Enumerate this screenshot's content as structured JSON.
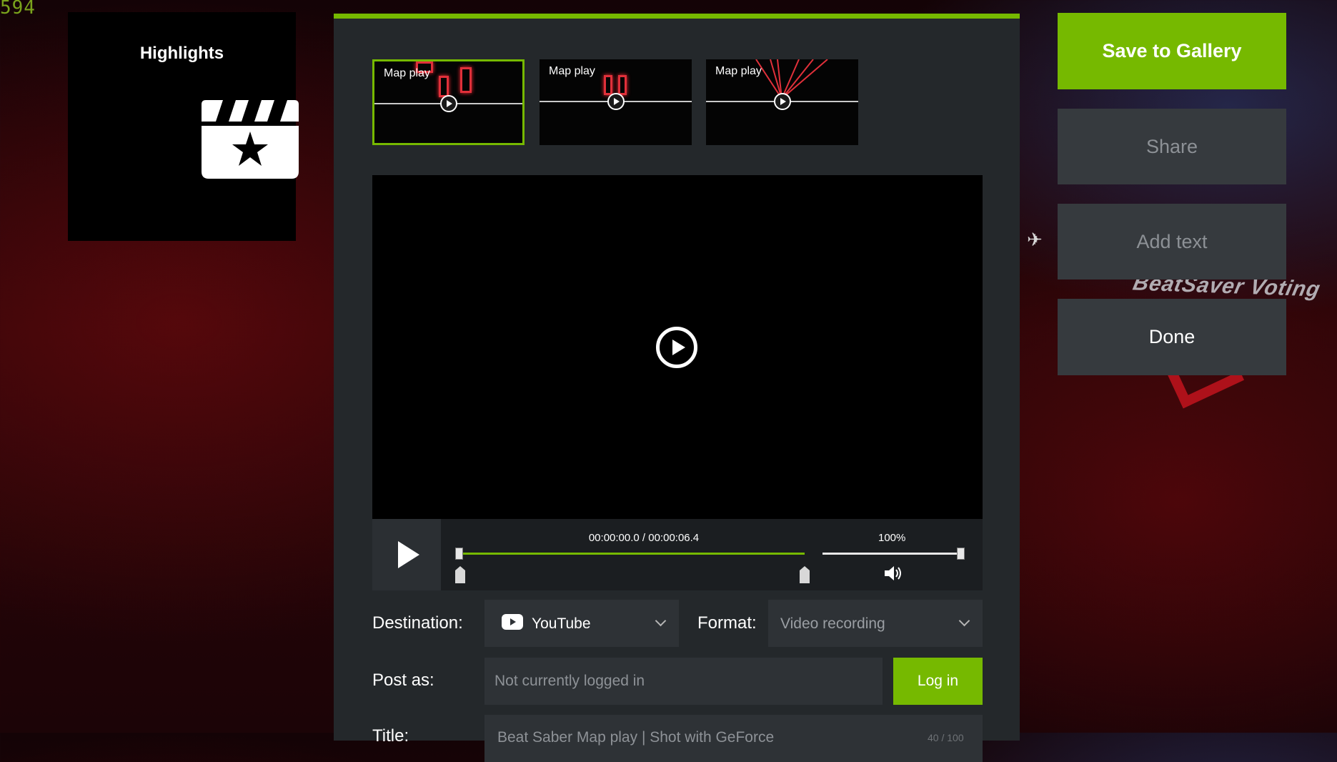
{
  "background": {
    "counter": "594",
    "deco_text": "BeatSaver Voting"
  },
  "highlights": {
    "title": "Highlights",
    "icon": "clapperboard-star-icon"
  },
  "thumbnails": [
    {
      "label": "Map play",
      "selected": true
    },
    {
      "label": "Map play",
      "selected": false
    },
    {
      "label": "Map play",
      "selected": false
    }
  ],
  "player": {
    "timecode": "00:00:00.0 / 00:00:06.4",
    "volume_label": "100%",
    "volume": 1.0
  },
  "form": {
    "destination_label": "Destination:",
    "destination_value": "YouTube",
    "format_label": "Format:",
    "format_value": "Video recording",
    "post_as_label": "Post as:",
    "post_as_placeholder": "Not currently logged in",
    "login_label": "Log in",
    "title_label": "Title:",
    "title_value": "Beat Saber Map play | Shot with GeForce",
    "title_counter": "40 / 100"
  },
  "actions": {
    "save": "Save to Gallery",
    "share": "Share",
    "add_text": "Add text",
    "done": "Done"
  },
  "colors": {
    "accent": "#76b900",
    "panel": "#24282b",
    "button_dark": "#363a3e"
  }
}
